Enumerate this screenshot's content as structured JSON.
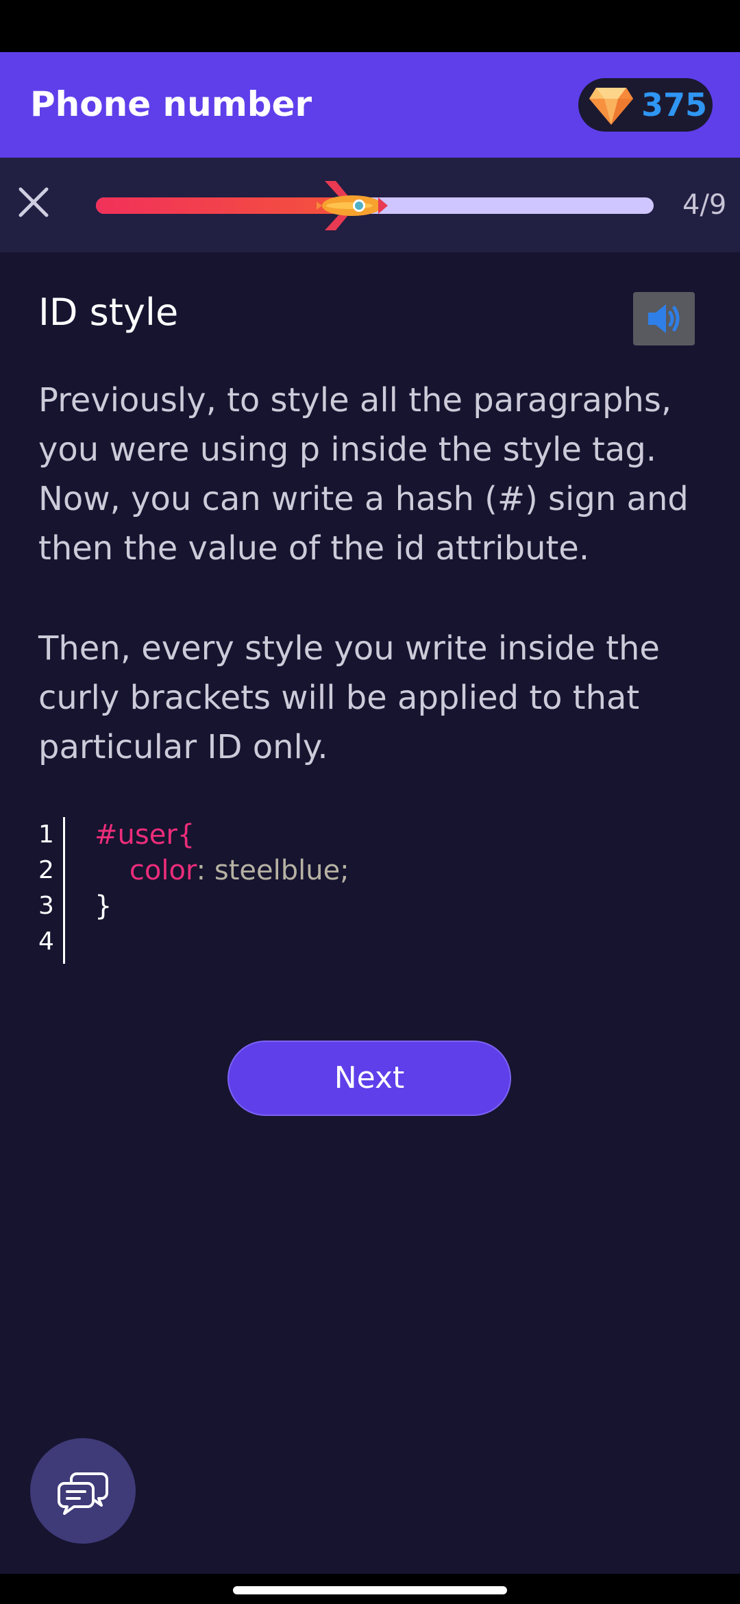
{
  "header": {
    "title": "Phone number",
    "gems": {
      "icon": "diamond-icon",
      "count": "375"
    }
  },
  "progress": {
    "close_icon": "close-icon",
    "current": 4,
    "total": 9,
    "label": "4/9",
    "fraction": 0.46,
    "marker_icon": "rocket-icon"
  },
  "lesson": {
    "title": "ID style",
    "audio_icon": "speaker-icon",
    "paragraphs": [
      "Previously, to style all the paragraphs, you were using p inside the style tag. Now, you can write a hash (#) sign and then the value of the id attribute.",
      "Then, every style you write inside the curly brackets will be applied to that particular ID only."
    ]
  },
  "code": {
    "line_numbers": [
      "1",
      "2",
      "3",
      "4"
    ],
    "line1": "#user{",
    "line2_prop": "color",
    "line2_colon": ":",
    "line2_value": " steelblue;",
    "line3": "}"
  },
  "actions": {
    "next_label": "Next"
  },
  "chat": {
    "icon": "chat-bubbles-icon"
  },
  "colors": {
    "header": "#5f3fea",
    "background": "#16142f",
    "accent_pink": "#ec2d7a",
    "gem_count": "#2f96f3"
  }
}
